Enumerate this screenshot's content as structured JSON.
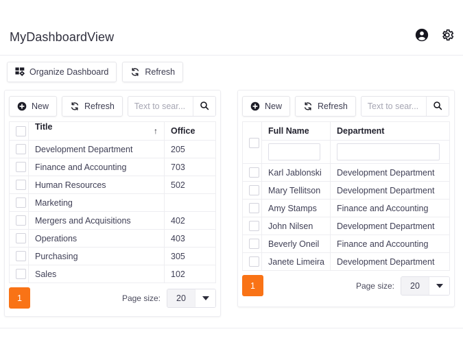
{
  "header": {
    "title": "MyDashboardView",
    "icons": [
      {
        "name": "account-icon",
        "label": "account"
      },
      {
        "name": "settings-gear-icon",
        "label": "settings"
      }
    ]
  },
  "dashboard_toolbar": {
    "organize_label": "Organize Dashboard",
    "refresh_label": "Refresh"
  },
  "colors": {
    "accent_orange": "#f97316",
    "border": "#ededf1",
    "text": "#3b3b4f",
    "placeholder": "#a6a6b3"
  },
  "left_panel": {
    "toolbar": {
      "new_label": "New",
      "refresh_label": "Refresh",
      "search_placeholder": "Text to sear...",
      "search_value": ""
    },
    "columns": [
      "Title",
      "Office"
    ],
    "sort": {
      "column": "Title",
      "direction": "ascending",
      "glyph": "↑"
    },
    "rows": [
      {
        "title": "Development Department",
        "office": "205"
      },
      {
        "title": "Finance and Accounting",
        "office": "703"
      },
      {
        "title": "Human Resources",
        "office": "502"
      },
      {
        "title": "Marketing",
        "office": ""
      },
      {
        "title": "Mergers and Acquisitions",
        "office": "402"
      },
      {
        "title": "Operations",
        "office": "403"
      },
      {
        "title": "Purchasing",
        "office": "305"
      },
      {
        "title": "Sales",
        "office": "102"
      }
    ],
    "pager": {
      "current_page": "1",
      "page_size_label": "Page size:",
      "page_size_value": "20"
    }
  },
  "right_panel": {
    "toolbar": {
      "new_label": "New",
      "refresh_label": "Refresh",
      "search_placeholder": "Text to sear...",
      "search_value": ""
    },
    "columns": [
      "Full Name",
      "Department"
    ],
    "filters": {
      "full_name": "",
      "department": ""
    },
    "rows": [
      {
        "full_name": "Karl Jablonski",
        "department": "Development Department"
      },
      {
        "full_name": "Mary Tellitson",
        "department": "Development Department"
      },
      {
        "full_name": "Amy Stamps",
        "department": "Finance and Accounting"
      },
      {
        "full_name": "John Nilsen",
        "department": "Development Department"
      },
      {
        "full_name": "Beverly Oneil",
        "department": "Finance and Accounting"
      },
      {
        "full_name": "Janete Limeira",
        "department": "Development Department"
      }
    ],
    "pager": {
      "current_page": "1",
      "page_size_label": "Page size:",
      "page_size_value": "20"
    }
  }
}
